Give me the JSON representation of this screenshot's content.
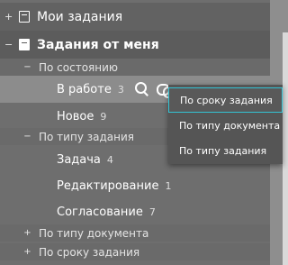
{
  "tree": {
    "my_tasks": {
      "toggle": "+",
      "label": "Мои задания"
    },
    "from_me": {
      "toggle": "−",
      "label": "Задания от меня",
      "groups": [
        {
          "toggle": "−",
          "label": "По состоянию",
          "items": [
            {
              "label": "В работе",
              "count": "3"
            },
            {
              "label": "Новое",
              "count": "9"
            }
          ]
        },
        {
          "toggle": "−",
          "label": "По типу задания",
          "items": [
            {
              "label": "Задача",
              "count": "4"
            },
            {
              "label": "Редактирование",
              "count": "1"
            },
            {
              "label": "Согласование",
              "count": "7"
            }
          ]
        },
        {
          "toggle": "+",
          "label": "По типу документа"
        },
        {
          "toggle": "+",
          "label": "По сроку задания"
        }
      ]
    }
  },
  "selected_item_icons": [
    "search-icon",
    "link-icon"
  ],
  "grouping_menu": {
    "items": [
      "По сроку задания",
      "По типу документа",
      "По типу задания"
    ],
    "highlighted_index": 0
  },
  "colors": {
    "highlight_border": "#33c3d4",
    "selected_row": "#8c8c8c"
  }
}
